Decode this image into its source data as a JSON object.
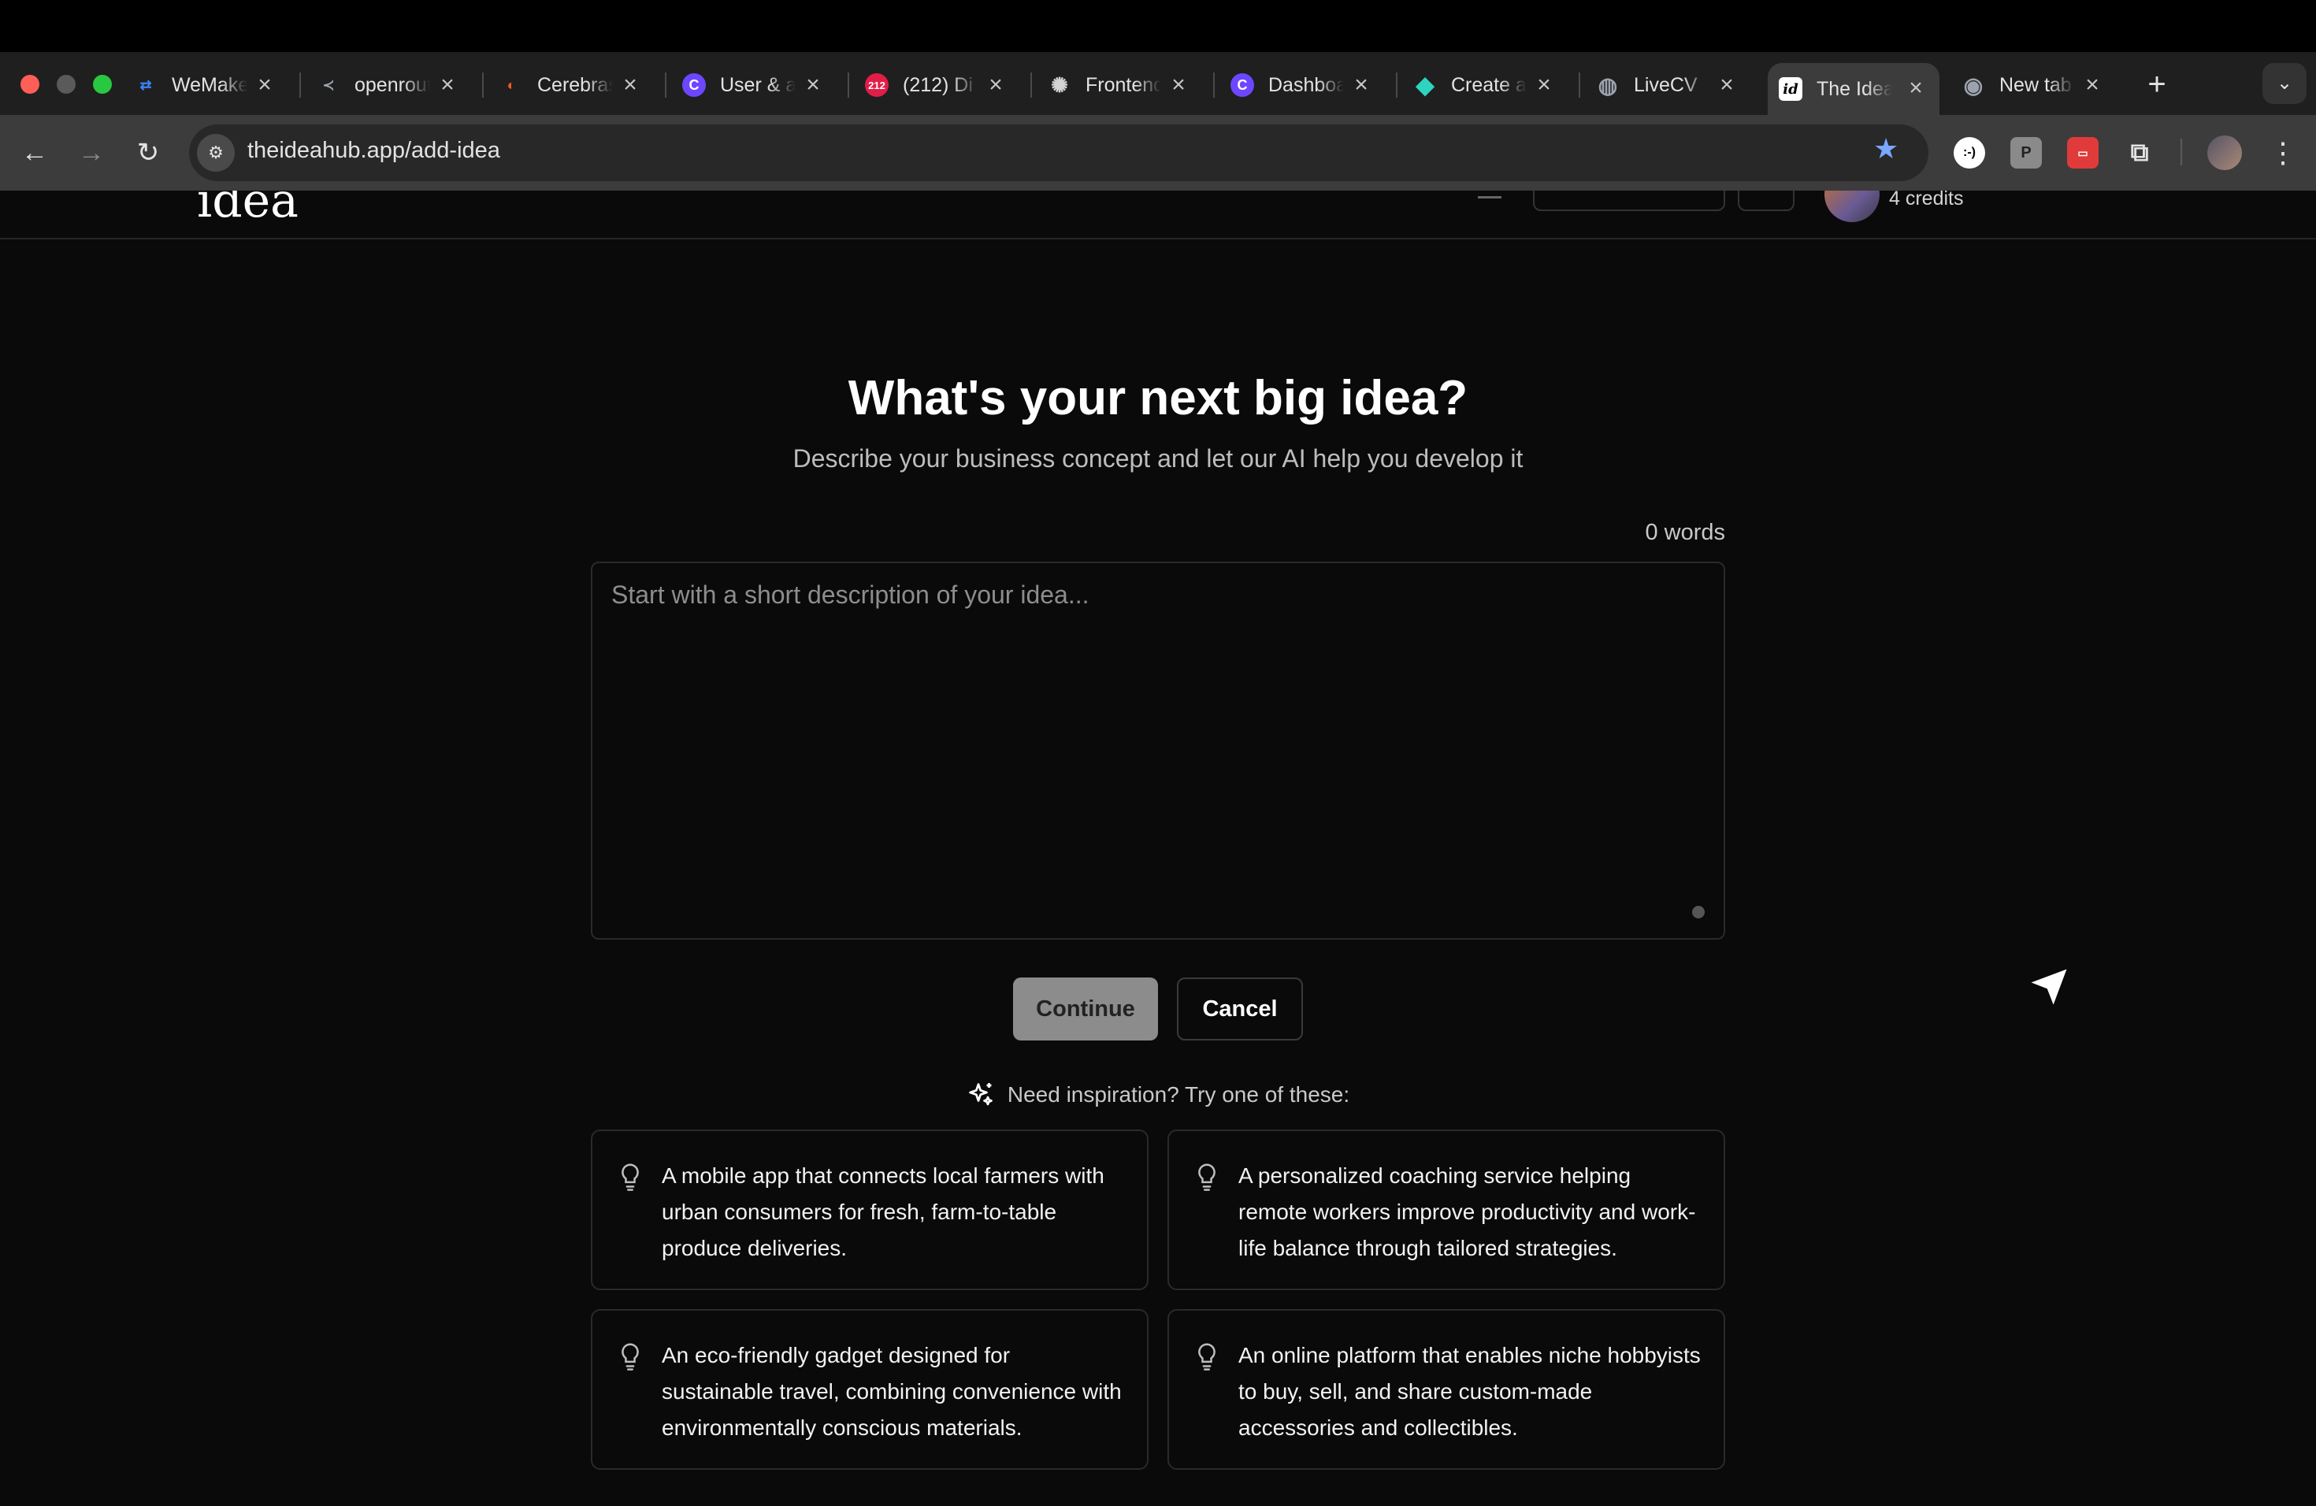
{
  "browser": {
    "tabs": [
      {
        "title": "WeMake",
        "favicon": "wemake-icon",
        "favicon_color": "#3b82f6",
        "active": false
      },
      {
        "title": "openrouter",
        "favicon": "openrouter-icon",
        "favicon_color": "#9ca3af",
        "active": false
      },
      {
        "title": "Cerebras",
        "favicon": "cerebras-icon",
        "favicon_color": "#f05a28",
        "active": false
      },
      {
        "title": "User & account",
        "favicon": "clerk-icon",
        "favicon_color": "#6c47ff",
        "active": false
      },
      {
        "title": "(212) Di",
        "favicon": "youtube-icon",
        "favicon_color": "#e11d48",
        "active": false
      },
      {
        "title": "Frontend",
        "favicon": "openai-icon",
        "favicon_color": "#d4d4d4",
        "active": false
      },
      {
        "title": "Dashboard",
        "favicon": "clerk-icon",
        "favicon_color": "#6c47ff",
        "active": false
      },
      {
        "title": "Create a",
        "favicon": "diamond-icon",
        "favicon_color": "#2dd4bf",
        "active": false
      },
      {
        "title": "LiveCV",
        "favicon": "globe-icon",
        "favicon_color": "#9ca3af",
        "active": false
      },
      {
        "title": "The Idea Hub",
        "favicon": "ideahub-icon",
        "favicon_color": "#ffffff",
        "active": true
      },
      {
        "title": "New tab",
        "favicon": "chrome-icon",
        "favicon_color": "#9ca3af",
        "active": false
      }
    ],
    "url": "theideahub.app/add-idea",
    "bookmark_star_color": "#7aa7ff"
  },
  "header": {
    "logo_text": "idea",
    "credits": "4 credits"
  },
  "main": {
    "title": "What's your next big idea?",
    "subtitle": "Describe your business concept and let our AI help you develop it",
    "word_count": "0 words",
    "textarea_placeholder": "Start with a short description of your idea...",
    "continue_label": "Continue",
    "cancel_label": "Cancel",
    "inspiration_label": "Need inspiration? Try one of these:",
    "suggestions": [
      "A mobile app that connects local farmers with urban consumers for fresh, farm-to-table produce deliveries.",
      "A personalized coaching service helping remote workers improve productivity and work-life balance through tailored strategies.",
      "An eco-friendly gadget designed for sustainable travel, combining convenience with environmentally conscious materials.",
      "An online platform that enables niche hobbyists to buy, sell, and share custom-made accessories and collectibles."
    ]
  }
}
